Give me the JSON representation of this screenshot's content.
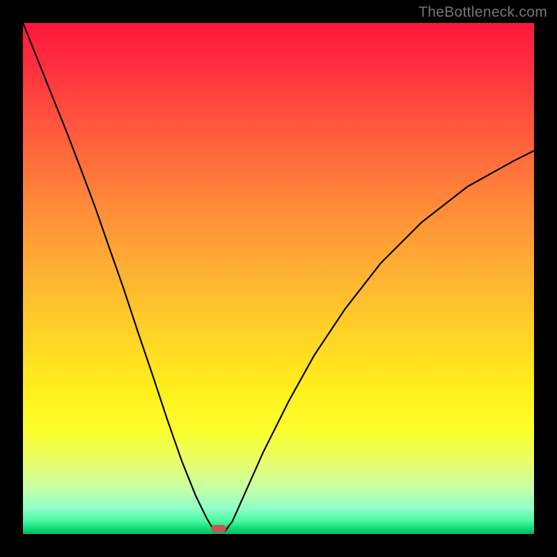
{
  "watermark": "TheBottleneck.com",
  "marker": {
    "color": "#c1594f",
    "x_frac": 0.383,
    "y_frac": 0.99
  },
  "chart_data": {
    "type": "line",
    "title": "",
    "xlabel": "",
    "ylabel": "",
    "xlim": [
      0,
      1
    ],
    "ylim": [
      0,
      1
    ],
    "grid": false,
    "legend": false,
    "background_gradient": {
      "direction": "vertical",
      "stops": [
        {
          "pos": 0.0,
          "color": "#ff163e"
        },
        {
          "pos": 0.08,
          "color": "#ff2e3f"
        },
        {
          "pos": 0.22,
          "color": "#ff5d3d"
        },
        {
          "pos": 0.36,
          "color": "#ff8b39"
        },
        {
          "pos": 0.5,
          "color": "#ffb432"
        },
        {
          "pos": 0.62,
          "color": "#ffd626"
        },
        {
          "pos": 0.72,
          "color": "#fff01a"
        },
        {
          "pos": 0.8,
          "color": "#fbff2f"
        },
        {
          "pos": 0.86,
          "color": "#e8ff6c"
        },
        {
          "pos": 0.91,
          "color": "#c6ffa7"
        },
        {
          "pos": 0.95,
          "color": "#8effc9"
        },
        {
          "pos": 0.975,
          "color": "#4af79e"
        },
        {
          "pos": 0.99,
          "color": "#0ada77"
        },
        {
          "pos": 1.0,
          "color": "#06b85f"
        }
      ]
    },
    "series": [
      {
        "name": "bottleneck-curve",
        "stroke": "#000000",
        "note": "y = |x - x_min| shaped notch; values as fraction of plot height from bottom (1 = top edge, 0 = bottom edge)",
        "x": [
          0.0,
          0.028,
          0.056,
          0.085,
          0.113,
          0.141,
          0.169,
          0.197,
          0.225,
          0.254,
          0.282,
          0.31,
          0.338,
          0.36,
          0.375,
          0.395,
          0.41,
          0.43,
          0.47,
          0.52,
          0.57,
          0.63,
          0.7,
          0.78,
          0.87,
          0.96,
          1.0
        ],
        "y": [
          1.0,
          0.93,
          0.86,
          0.788,
          0.715,
          0.64,
          0.56,
          0.48,
          0.395,
          0.31,
          0.225,
          0.145,
          0.075,
          0.03,
          0.005,
          0.005,
          0.025,
          0.07,
          0.16,
          0.26,
          0.35,
          0.44,
          0.53,
          0.61,
          0.68,
          0.73,
          0.75
        ]
      }
    ],
    "highlight_point": {
      "x": 0.383,
      "y": 0.01,
      "color": "#c1594f"
    }
  }
}
